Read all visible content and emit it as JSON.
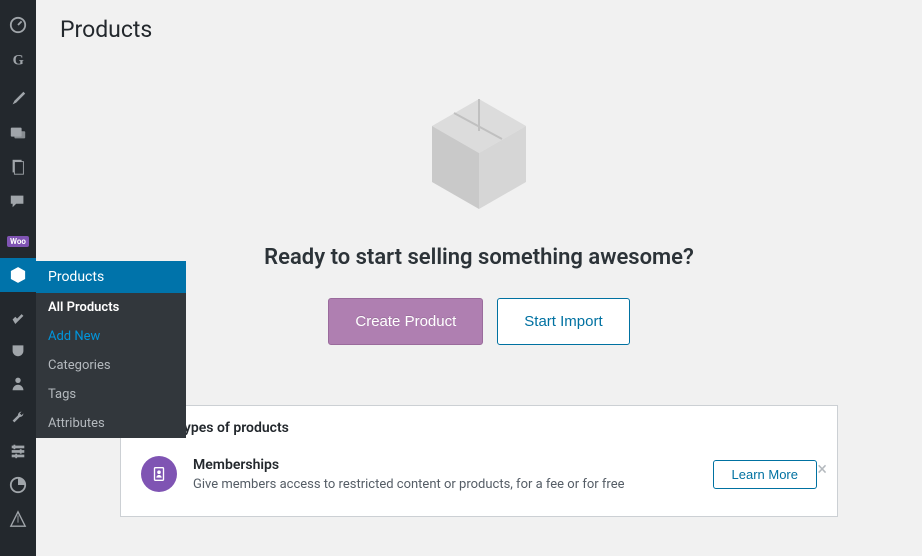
{
  "page": {
    "title": "Products"
  },
  "submenu": {
    "header": "Products",
    "items": [
      "All Products",
      "Add New",
      "Categories",
      "Tags",
      "Attributes"
    ]
  },
  "emptyState": {
    "heading": "Ready to start selling something awesome?",
    "createButton": "Create Product",
    "importButton": "Start Import"
  },
  "otherProducts": {
    "heading": "Other types of products",
    "membership": {
      "title": "Memberships",
      "description": "Give members access to restricted content or products, for a fee or for free",
      "learnMore": "Learn More"
    }
  }
}
